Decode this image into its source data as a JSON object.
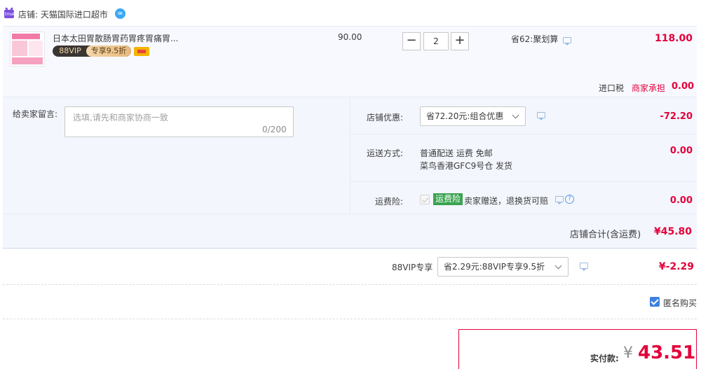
{
  "shop": {
    "icon_name": "tmall-cat-icon",
    "icon_text": "tmall",
    "label": "店铺: 天猫国际进口超市",
    "wangwang_icon": "wangwang-chat-icon"
  },
  "item": {
    "title": "日本太田胃散肠胃药胃疼胃痛胃...",
    "vip_badge_left": "88VIP",
    "vip_badge_right": "专享9.5折",
    "card_icon": "credit-card-icon",
    "unit_price": "90.00",
    "quantity": "2",
    "minus_label": "−",
    "plus_label": "+",
    "discount_text": "省62:聚划算",
    "subtotal": "118.00",
    "tax_label": "进口税",
    "tax_merchant": "商家承担",
    "tax_value": "0.00"
  },
  "remark": {
    "label": "给卖家留言:",
    "placeholder": "选填,请先和商家协商一致",
    "counter": "0/200"
  },
  "promo": {
    "label": "店铺优惠:",
    "selected": "省72.20元:组合优惠",
    "value": "-72.20"
  },
  "shipping": {
    "label": "运送方式:",
    "line1": "普通配送 运费 免邮",
    "line2": "菜鸟香港GFC9号仓  发货",
    "value": "0.00"
  },
  "insurance": {
    "label": "运费险:",
    "badge": "运费险",
    "desc": "卖家赠送，退换货可赔",
    "value": "0.00",
    "help_glyph": "?"
  },
  "store_total": {
    "label": "店铺合计(含运费)",
    "value": "¥45.80"
  },
  "vip": {
    "label": "88VIP专享",
    "selected": "省2.29元:88VIP专享9.5折",
    "value": "¥-2.29"
  },
  "anonymous": {
    "label": "匿名购买",
    "checked": true
  },
  "payment": {
    "label": "实付款:",
    "currency": "¥",
    "value": "43.51"
  },
  "colors": {
    "accent_red": "#e4003a",
    "panel_bg": "#f3f6fd",
    "insurance_green": "#39a34f",
    "checkbox_blue": "#3d80df"
  }
}
